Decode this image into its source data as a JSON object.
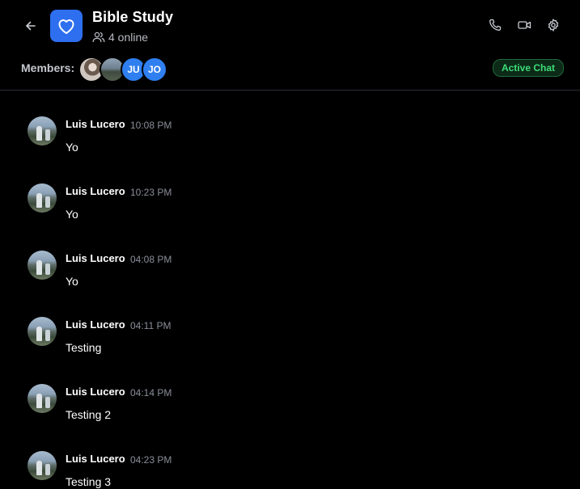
{
  "header": {
    "title": "Bible Study",
    "online_text": "4 online",
    "members_label": "Members:",
    "status_badge": "Active Chat",
    "icons": {
      "back": "arrow-left-icon",
      "group": "heart-icon",
      "users": "users-icon",
      "call": "phone-icon",
      "video": "video-icon",
      "settings": "gear-icon"
    }
  },
  "members": [
    {
      "type": "photo",
      "initials": ""
    },
    {
      "type": "photo",
      "initials": ""
    },
    {
      "type": "initials",
      "initials": "JU"
    },
    {
      "type": "initials",
      "initials": "JO"
    }
  ],
  "messages": [
    {
      "author": "Luis Lucero",
      "time": "10:08 PM",
      "text": "Yo"
    },
    {
      "author": "Luis Lucero",
      "time": "10:23 PM",
      "text": "Yo"
    },
    {
      "author": "Luis Lucero",
      "time": "04:08 PM",
      "text": "Yo"
    },
    {
      "author": "Luis Lucero",
      "time": "04:11 PM",
      "text": "Testing"
    },
    {
      "author": "Luis Lucero",
      "time": "04:14 PM",
      "text": "Testing 2"
    },
    {
      "author": "Luis Lucero",
      "time": "04:23 PM",
      "text": "Testing 3"
    }
  ],
  "colors": {
    "background": "#000000",
    "accent": "#2e6ff0",
    "active_green": "#3ddc79",
    "muted_text": "#8a8e99"
  }
}
